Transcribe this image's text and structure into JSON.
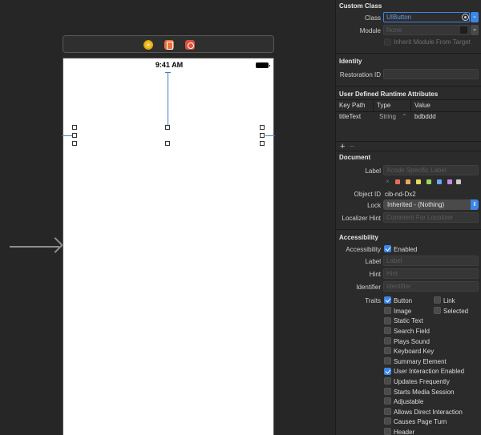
{
  "scene_dock": {
    "view_controller_icon": "view-controller-icon",
    "first_responder_icon": "first-responder-icon",
    "exit_icon": "exit-icon"
  },
  "device": {
    "status_time": "9:41 AM"
  },
  "custom_class": {
    "section_title": "Custom Class",
    "class_label": "Class",
    "class_placeholder": "UIButton",
    "module_label": "Module",
    "module_placeholder": "None",
    "inherit_label": "Inherit Module From Target"
  },
  "identity": {
    "section_title": "Identity",
    "restoration_label": "Restoration ID"
  },
  "runtime_attributes": {
    "section_title": "User Defined Runtime Attributes",
    "columns": [
      "Key Path",
      "Type",
      "Value"
    ],
    "row": {
      "key_path": "titleText",
      "type": "String",
      "value": "bdbddd"
    },
    "add_label": "+",
    "remove_label": "−"
  },
  "document": {
    "section_title": "Document",
    "label_label": "Label",
    "label_placeholder": "Xcode Specific Label",
    "clear_glyph": "×",
    "swatch_colors": [
      "#e96b5a",
      "#efa65b",
      "#eed65a",
      "#9fd561",
      "#6aa7ee",
      "#c28be4",
      "#c9c9c9"
    ],
    "object_id_label": "Object ID",
    "object_id_value": "cib-nd-Dx2",
    "lock_label": "Lock",
    "lock_value": "Inherited - (Nothing)",
    "localizer_label": "Localizer Hint",
    "localizer_placeholder": "Comment For Localizer"
  },
  "accessibility": {
    "section_title": "Accessibility",
    "accessibility_label": "Accessibility",
    "enabled_label": "Enabled",
    "label_label": "Label",
    "label_placeholder": "Label",
    "hint_label": "Hint",
    "hint_placeholder": "Hint",
    "identifier_label": "Identifier",
    "identifier_placeholder": "Identifier",
    "traits_label": "Traits",
    "traits": {
      "button": "Button",
      "link": "Link",
      "image": "Image",
      "selected": "Selected",
      "static_text": "Static Text",
      "search_field": "Search Field",
      "plays_sound": "Plays Sound",
      "keyboard_key": "Keyboard Key",
      "summary_element": "Summary Element",
      "user_interaction": "User Interaction Enabled",
      "updates_frequently": "Updates Frequently",
      "starts_media": "Starts Media Session",
      "adjustable": "Adjustable",
      "direct_interaction": "Allows Direct Interaction",
      "causes_page_turn": "Causes Page Turn",
      "header": "Header"
    }
  }
}
